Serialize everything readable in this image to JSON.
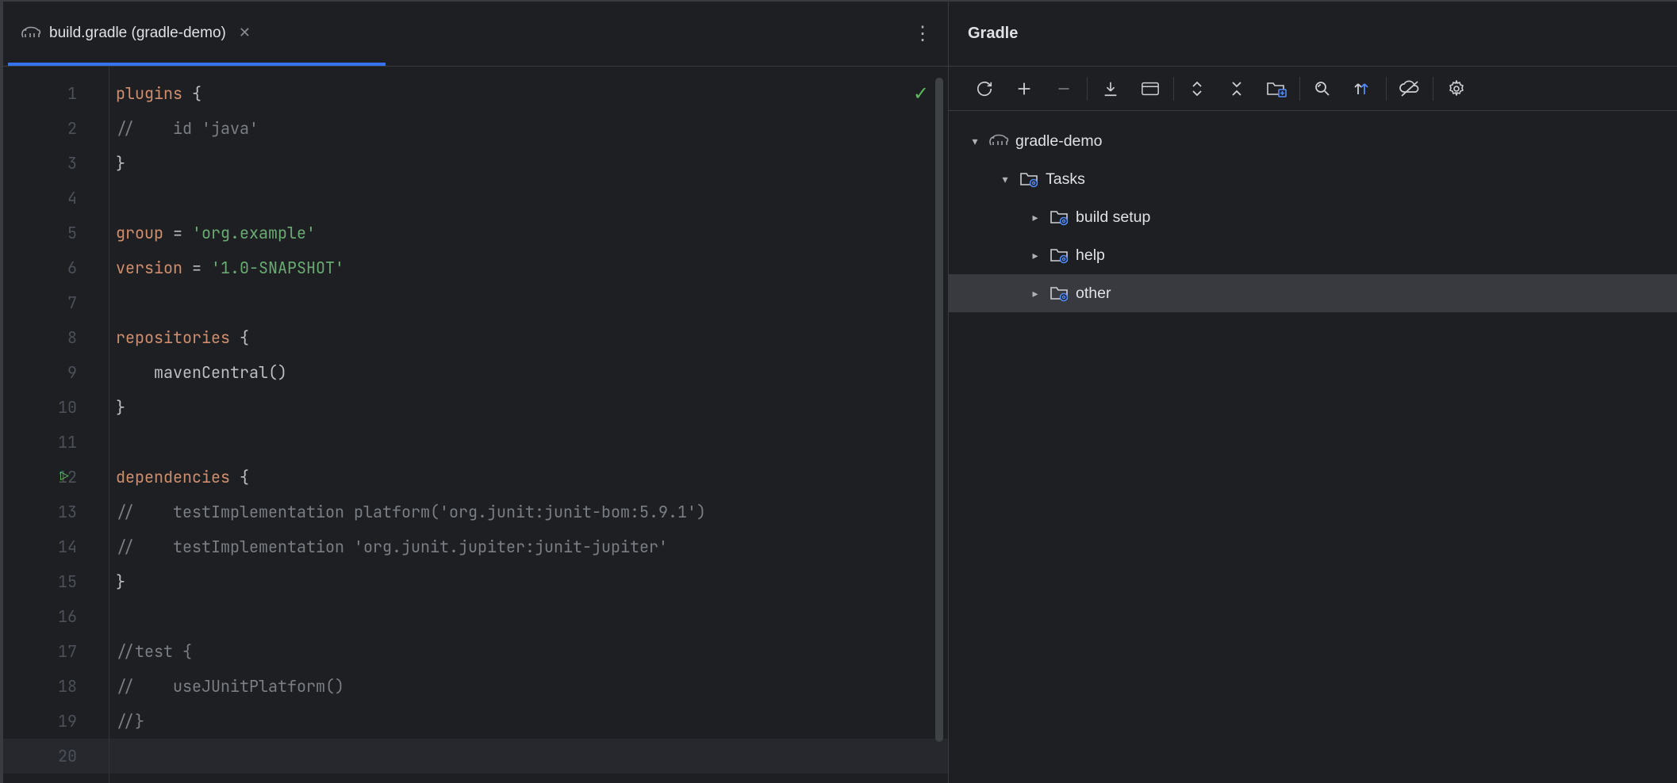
{
  "tab": {
    "filename": "build.gradle (gradle-demo)"
  },
  "code": {
    "lines": [
      {
        "n": 1,
        "tokens": [
          [
            "plugins ",
            "kw"
          ],
          [
            "{",
            "op"
          ]
        ]
      },
      {
        "n": 2,
        "tokens": [
          [
            "//    id 'java'",
            "cmt"
          ]
        ]
      },
      {
        "n": 3,
        "tokens": [
          [
            "}",
            "op"
          ]
        ]
      },
      {
        "n": 4,
        "tokens": []
      },
      {
        "n": 5,
        "tokens": [
          [
            "group",
            "kw"
          ],
          [
            " = ",
            "op"
          ],
          [
            "'org.example'",
            "str"
          ]
        ]
      },
      {
        "n": 6,
        "tokens": [
          [
            "version",
            "kw"
          ],
          [
            " = ",
            "op"
          ],
          [
            "'1.0-SNAPSHOT'",
            "str"
          ]
        ]
      },
      {
        "n": 7,
        "tokens": []
      },
      {
        "n": 8,
        "tokens": [
          [
            "repositories ",
            "kw"
          ],
          [
            "{",
            "op"
          ]
        ]
      },
      {
        "n": 9,
        "tokens": [
          [
            "    mavenCentral()",
            "op"
          ]
        ]
      },
      {
        "n": 10,
        "tokens": [
          [
            "}",
            "op"
          ]
        ]
      },
      {
        "n": 11,
        "tokens": []
      },
      {
        "n": 12,
        "tokens": [
          [
            "dependencies ",
            "kw"
          ],
          [
            "{",
            "op"
          ]
        ],
        "run": true
      },
      {
        "n": 13,
        "tokens": [
          [
            "//    testImplementation platform('org.junit:junit-bom:5.9.1')",
            "cmt"
          ]
        ]
      },
      {
        "n": 14,
        "tokens": [
          [
            "//    testImplementation 'org.junit.jupiter:junit-jupiter'",
            "cmt"
          ]
        ]
      },
      {
        "n": 15,
        "tokens": [
          [
            "}",
            "op"
          ]
        ]
      },
      {
        "n": 16,
        "tokens": []
      },
      {
        "n": 17,
        "tokens": [
          [
            "//test {",
            "cmt"
          ]
        ]
      },
      {
        "n": 18,
        "tokens": [
          [
            "//    useJUnitPlatform()",
            "cmt"
          ]
        ]
      },
      {
        "n": 19,
        "tokens": [
          [
            "//}",
            "cmt"
          ]
        ]
      },
      {
        "n": 20,
        "tokens": [],
        "caret": true
      }
    ]
  },
  "gradlePanel": {
    "title": "Gradle",
    "tree": {
      "root": {
        "label": "gradle-demo",
        "expanded": true
      },
      "tasks": {
        "label": "Tasks",
        "expanded": true,
        "children": [
          {
            "id": "build-setup",
            "label": "build setup",
            "expanded": false
          },
          {
            "id": "help",
            "label": "help",
            "expanded": false
          },
          {
            "id": "other",
            "label": "other",
            "expanded": false,
            "hovered": true
          }
        ]
      }
    }
  }
}
